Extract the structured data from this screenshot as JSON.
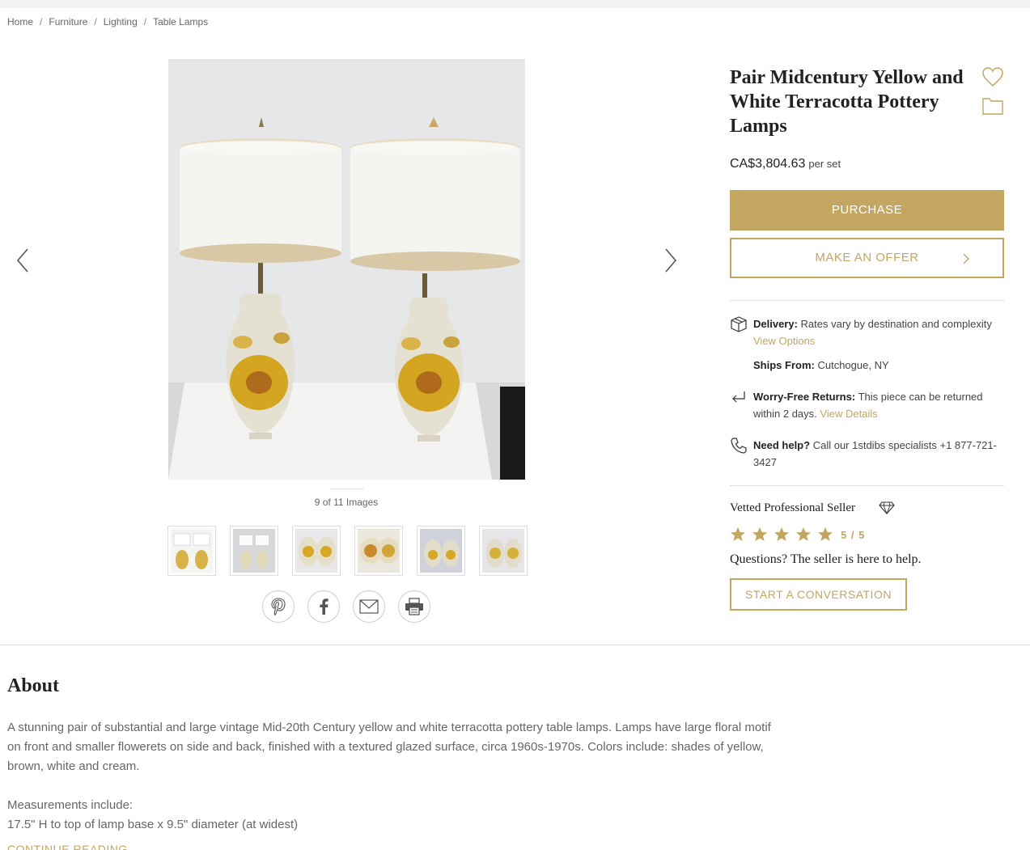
{
  "breadcrumb": [
    "Home",
    "Furniture",
    "Lighting",
    "Table Lamps"
  ],
  "gallery": {
    "counter": "9 of 11 Images",
    "thumbnail_count": 6
  },
  "share": [
    "pinterest-icon",
    "facebook-icon",
    "email-icon",
    "print-icon"
  ],
  "product": {
    "title": "Pair Midcentury Yellow and White Terracotta Pottery Lamps",
    "price": "CA$3,804.63",
    "price_unit": "per set"
  },
  "actions": {
    "purchase": "PURCHASE",
    "offer": "MAKE AN OFFER"
  },
  "shipping": {
    "delivery_label": "Delivery:",
    "delivery_text": "Rates vary by destination and complexity",
    "view_options": "View Options",
    "ships_from_label": "Ships From:",
    "ships_from": "Cutchogue, NY",
    "returns_label": "Worry-Free Returns:",
    "returns_text": "This piece can be returned within 2 days.",
    "view_details": "View Details",
    "help_label": "Need help?",
    "help_text": "Call our 1stdibs specialists +1 877-721-3427"
  },
  "seller": {
    "vetted": "Vetted Professional Seller",
    "rating": "5 / 5",
    "stars": 5,
    "questions": "Questions? The seller is here to help.",
    "conversation": "START A CONVERSATION"
  },
  "about": {
    "heading": "About",
    "description": "A stunning pair of substantial and large vintage Mid-20th Century yellow and white terracotta pottery table lamps. Lamps have large floral motif on front and smaller flowerets on side and back, finished with a textured glazed surface, circa 1960s-1970s. Colors include: shades of yellow, brown, white and cream.",
    "measurements_label": "Measurements include:",
    "measurement": "17.5\" H to top of lamp base x 9.5\" diameter (at widest)",
    "continue": "CONTINUE READING"
  },
  "colors": {
    "accent": "#c2a661",
    "text": "#222222",
    "muted": "#666666"
  }
}
